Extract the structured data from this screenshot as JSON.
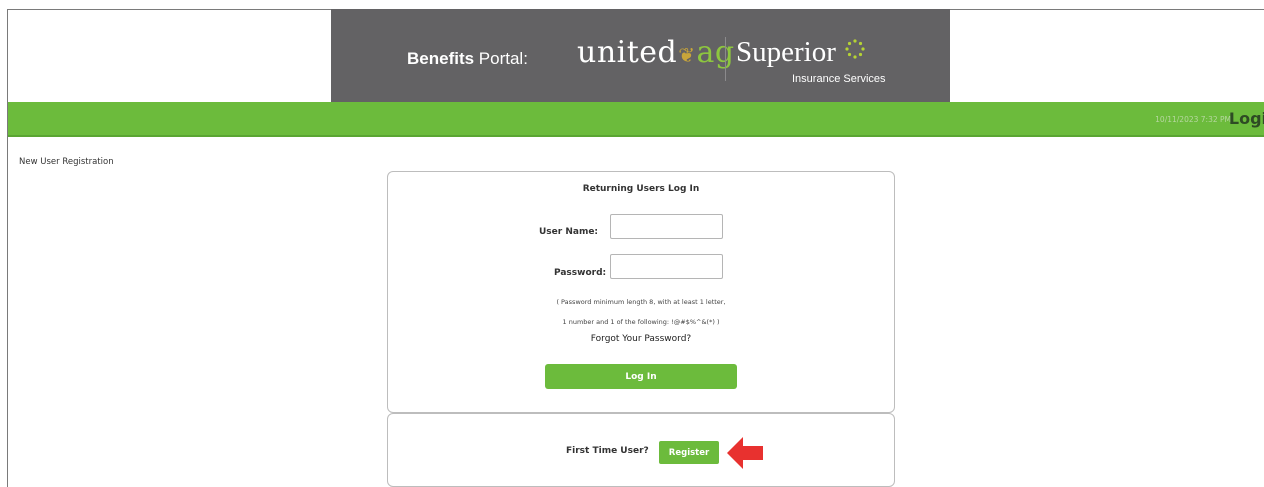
{
  "header": {
    "portal_label_bold": "Benefits",
    "portal_label_rest": " Portal:",
    "logo_united_1": "united",
    "logo_united_2": "ag",
    "logo_superior": "Superior",
    "logo_superior_sub": "Insurance Services",
    "background_color": "#636264"
  },
  "navbar": {
    "datetime": "10/11/2023 7:32 PM",
    "login_label": "Logi",
    "color": "#6cbb3c"
  },
  "sidebar": {
    "new_user_link": "New User Registration"
  },
  "login_panel": {
    "title": "Returning Users Log In",
    "username_label": "User Name:",
    "username_value": "",
    "password_label": "Password:",
    "password_value": "",
    "hint_line1": "( Password minimum length 8, with at least 1 letter,",
    "hint_line2": "1 number and 1 of the following: !@#$%^&(*) )",
    "forgot_link": "Forgot Your Password?",
    "login_button": "Log In"
  },
  "register_panel": {
    "prompt": "First Time User?",
    "register_button": "Register",
    "arrow_color": "#e8312f",
    "arrow_icon": "left-arrow-icon"
  }
}
